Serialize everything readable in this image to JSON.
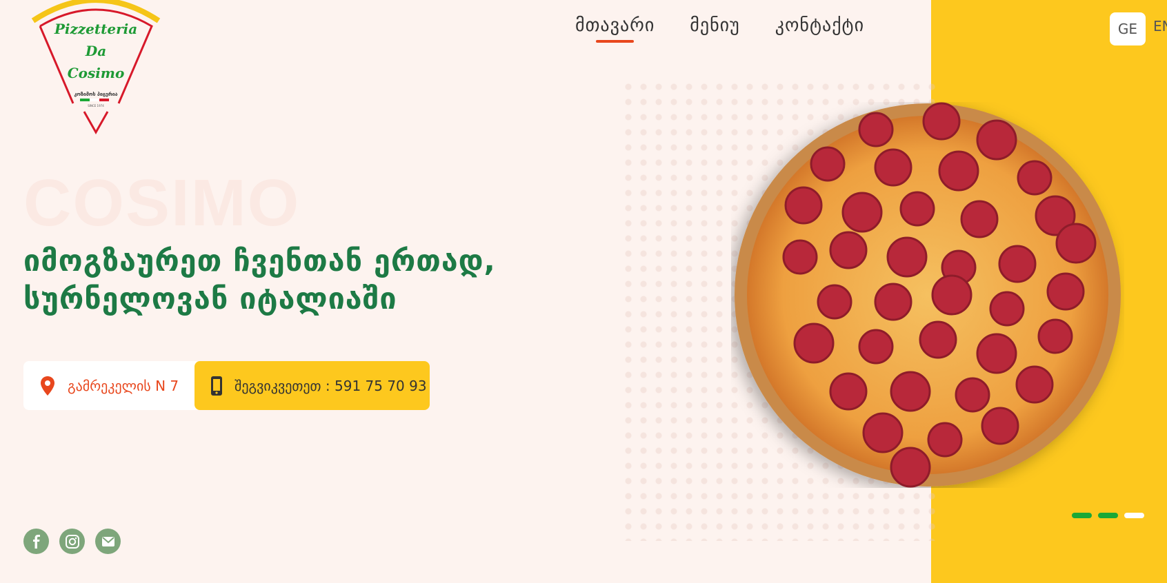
{
  "brand": {
    "logo_line1": "Pizzetteria",
    "logo_line2": "Da",
    "logo_line3": "Cosimo",
    "logo_subtitle": "კოზიმოს პიცერია",
    "logo_since": "SINCE 1974",
    "colors": {
      "green": "#1d7a45",
      "red": "#e8471d",
      "yellow": "#fdc81e"
    }
  },
  "nav": {
    "items": [
      {
        "label": "მთავარი",
        "active": true
      },
      {
        "label": "მენიუ",
        "active": false
      },
      {
        "label": "კონტაქტი",
        "active": false
      }
    ]
  },
  "language": {
    "current": "GE",
    "other": "EN"
  },
  "hero": {
    "watermark": "COSIMO",
    "headline_line1": "იმოგზაურეთ ჩვენთან ერთად,",
    "headline_line2": "სურნელოვან იტალიაში",
    "address": "გამრეკელის N 7",
    "phone": "შეგვიკვეთეთ : 591 75 70 93",
    "address_icon": "location-pin-icon",
    "phone_icon": "phone-icon",
    "image": "pepperoni-pizza"
  },
  "slider": {
    "count": 3,
    "current": 3
  },
  "social": {
    "icons": [
      "facebook-icon",
      "instagram-icon",
      "email-icon"
    ]
  }
}
